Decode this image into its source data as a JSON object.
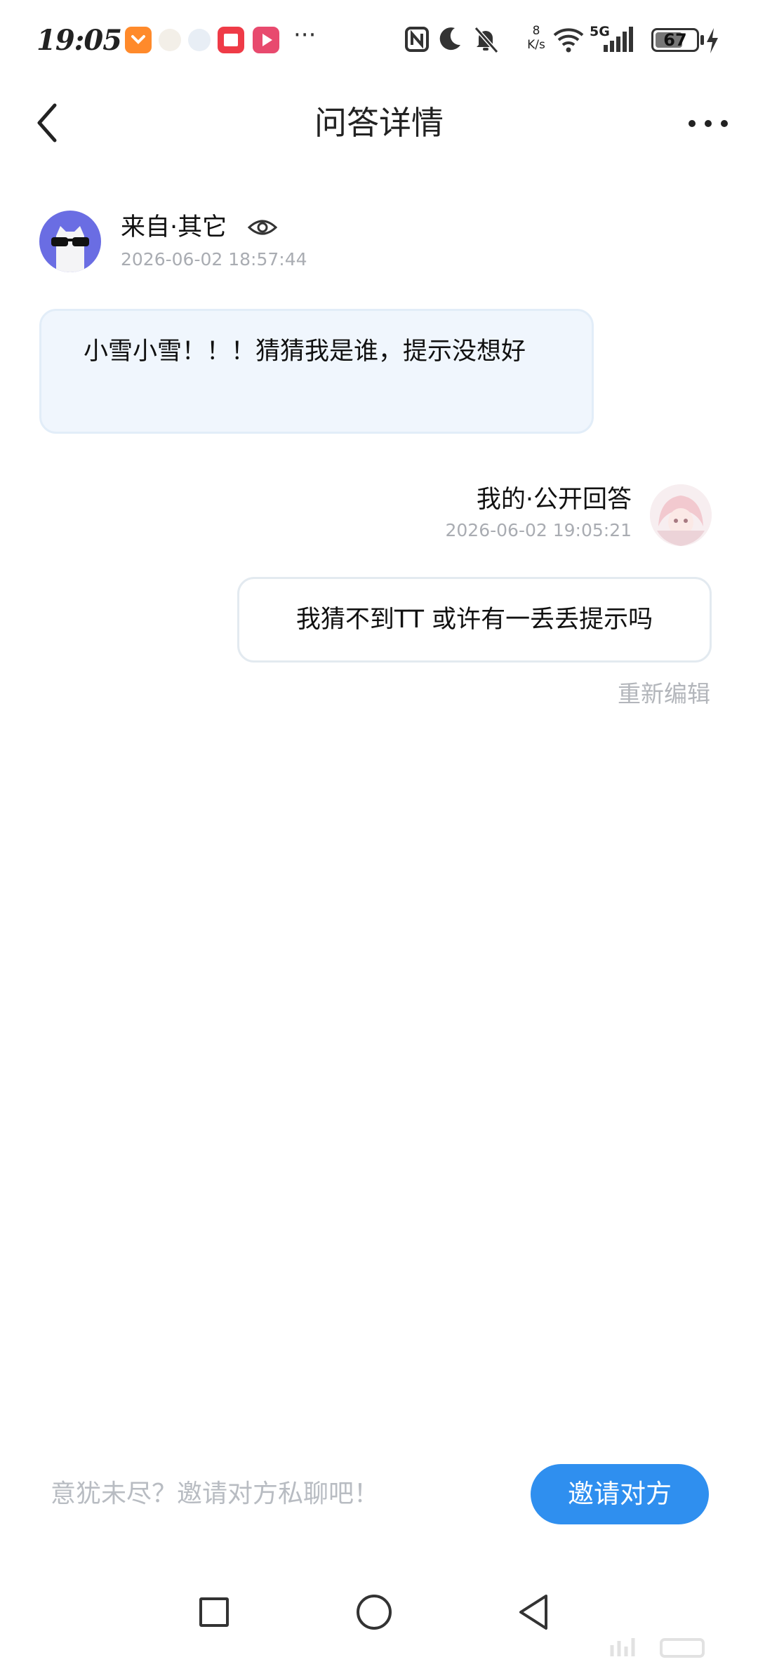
{
  "status_bar": {
    "time": "19:05",
    "net_speed_value": "8",
    "net_speed_unit": "K/s",
    "network": "5G",
    "battery": "67",
    "battery_level": 0.67,
    "icons": [
      "taobao-icon",
      "photo-icon",
      "photo-icon",
      "red-note-icon",
      "video-icon",
      "more-icon",
      "nfc-icon",
      "moon-icon",
      "mute-icon",
      "wifi-icon",
      "signal-icon",
      "battery-icon",
      "charging-icon"
    ]
  },
  "header": {
    "title": "问答详情"
  },
  "question": {
    "source": "来自·其它",
    "time": "2026-06-02 18:57:44",
    "text": "小雪小雪！！！猜猜我是谁，提示没想好"
  },
  "answer": {
    "source": "我的·公开回答",
    "time": "2026-06-02 19:05:21",
    "text": "我猜不到TT 或许有一丢丢提示吗",
    "edit_label": "重新编辑"
  },
  "bottom_bar": {
    "hint": "意犹未尽？邀请对方私聊吧！",
    "invite_label": "邀请对方"
  },
  "colors": {
    "accent": "#2f8fef",
    "question_bubble": "#f0f6fd",
    "muted_text": "#a9acb2",
    "avatar_left": "#6a6de3"
  }
}
